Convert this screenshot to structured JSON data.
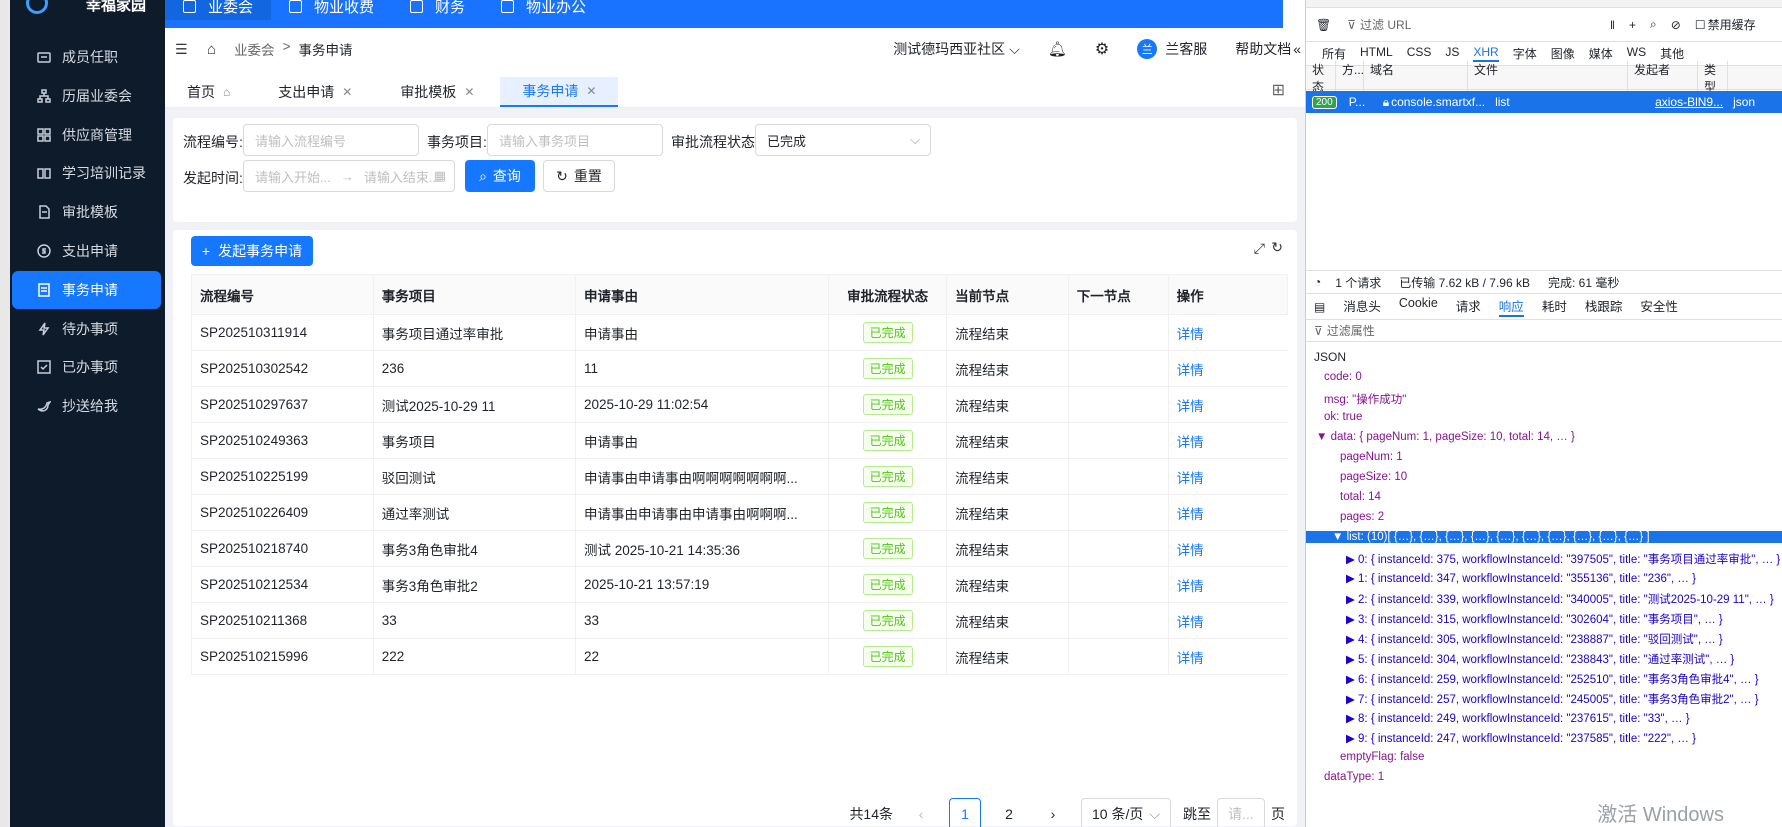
{
  "sidebar": {
    "brand": "幸福家园",
    "items": [
      {
        "label": "成员任职",
        "icon": "id-card-icon"
      },
      {
        "label": "历届业委会",
        "icon": "org-tree-icon"
      },
      {
        "label": "供应商管理",
        "icon": "grid-icon"
      },
      {
        "label": "学习培训记录",
        "icon": "book-icon"
      },
      {
        "label": "审批模板",
        "icon": "document-icon"
      },
      {
        "label": "支出申请",
        "icon": "dollar-icon"
      },
      {
        "label": "事务申请",
        "icon": "list-icon",
        "active": true
      },
      {
        "label": "待办事项",
        "icon": "lightning-icon"
      },
      {
        "label": "已办事项",
        "icon": "checkbox-icon"
      },
      {
        "label": "抄送给我",
        "icon": "bird-icon"
      }
    ]
  },
  "topnav": {
    "items": [
      {
        "label": "业委会",
        "active": true
      },
      {
        "label": "物业收费"
      },
      {
        "label": "财务"
      },
      {
        "label": "物业办公"
      }
    ]
  },
  "header": {
    "breadcrumb": [
      "业委会",
      ">",
      "事务申请"
    ],
    "community": "测试德玛西亚社区",
    "user": "兰客服",
    "user_avatar": "兰",
    "help": "帮助文档"
  },
  "tabs": [
    {
      "label": "首页",
      "closable": false
    },
    {
      "label": "支出申请",
      "closable": true
    },
    {
      "label": "审批模板",
      "closable": true
    },
    {
      "label": "事务申请",
      "closable": true,
      "active": true
    }
  ],
  "filter": {
    "flow_no_label": "流程编号:",
    "flow_no_placeholder": "请输入流程编号",
    "item_label": "事务项目:",
    "item_placeholder": "请输入事务项目",
    "status_label": "审批流程状态:",
    "status_value": "已完成",
    "time_label": "发起时间:",
    "time_start_placeholder": "请输入开始...",
    "time_end_placeholder": "请输入结束...",
    "query_btn": "查询",
    "reset_btn": "重置"
  },
  "create_btn": "发起事务申请",
  "table": {
    "columns": [
      "流程编号",
      "事务项目",
      "申请事由",
      "审批流程状态",
      "当前节点",
      "下一节点",
      "操作"
    ],
    "rows": [
      [
        "SP202510311914",
        "事务项目通过率审批",
        "申请事由",
        "已完成",
        "流程结束",
        "",
        "详情"
      ],
      [
        "SP202510302542",
        "236",
        "11",
        "已完成",
        "流程结束",
        "",
        "详情"
      ],
      [
        "SP202510297637",
        "测试2025-10-29 11",
        "2025-10-29 11:02:54",
        "已完成",
        "流程结束",
        "",
        "详情"
      ],
      [
        "SP202510249363",
        "事务项目",
        "申请事由",
        "已完成",
        "流程结束",
        "",
        "详情"
      ],
      [
        "SP202510225199",
        "驳回测试",
        "申请事由申请事由啊啊啊啊啊啊啊...",
        "已完成",
        "流程结束",
        "",
        "详情"
      ],
      [
        "SP202510226409",
        "通过率测试",
        "申请事由申请事由申请事由啊啊啊...",
        "已完成",
        "流程结束",
        "",
        "详情"
      ],
      [
        "SP202510218740",
        "事务3角色审批4",
        "测试 2025-10-21 14:35:36",
        "已完成",
        "流程结束",
        "",
        "详情"
      ],
      [
        "SP202510212534",
        "事务3角色审批2",
        "2025-10-21 13:57:19",
        "已完成",
        "流程结束",
        "",
        "详情"
      ],
      [
        "SP202510211368",
        "33",
        "33",
        "已完成",
        "流程结束",
        "",
        "详情"
      ],
      [
        "SP202510215996",
        "222",
        "22",
        "已完成",
        "流程结束",
        "",
        "详情"
      ]
    ]
  },
  "pager": {
    "total": "共14条",
    "pages": [
      "1",
      "2"
    ],
    "current": "1",
    "size": "10 条/页",
    "jump_label": "跳至",
    "jump_placeholder": "请...",
    "page_suffix": "页"
  },
  "devtools": {
    "filter_url": "过滤 URL",
    "disable_cache": "禁用缓存",
    "type_tabs": [
      "所有",
      "HTML",
      "CSS",
      "JS",
      "XHR",
      "字体",
      "图像",
      "媒体",
      "WS",
      "其他"
    ],
    "active_type": "XHR",
    "columns": [
      "状态",
      "方...",
      "域名",
      "文件",
      "发起者",
      "类型"
    ],
    "request": {
      "status": "200",
      "method": "P...",
      "domain": "console.smartxf...",
      "file": "list",
      "initiator": "axios-BlN9...",
      "type": "json"
    },
    "summary": {
      "count": "1 个请求",
      "transferred": "已传输 7.62 kB / 7.96 kB",
      "finish": "完成: 61 毫秒"
    },
    "detail_tabs": [
      "消息头",
      "Cookie",
      "请求",
      "响应",
      "耗时",
      "栈跟踪",
      "安全性"
    ],
    "active_detail": "响应",
    "filter_props": "过滤属性",
    "json_label": "JSON",
    "json_lines": [
      "code: 0",
      "msg: \"操作成功\"",
      "ok: true",
      "▼ data: { pageNum: 1, pageSize: 10, total: 14, … }",
      "pageNum: 1",
      "pageSize: 10",
      "total: 14",
      "pages: 2",
      "▼ list: (10)[ {…}, {…}, {…}, {…}, {…}, {…}, {…}, {…}, {…}, {…} ]",
      "▶ 0: { instanceId: 375, workflowInstanceId: \"397505\", title: \"事务项目通过率审批\", … }",
      "▶ 1: { instanceId: 347, workflowInstanceId: \"355136\", title: \"236\", … }",
      "▶ 2: { instanceId: 339, workflowInstanceId: \"340005\", title: \"测试2025-10-29 11\", … }",
      "▶ 3: { instanceId: 315, workflowInstanceId: \"302604\", title: \"事务项目\", … }",
      "▶ 4: { instanceId: 305, workflowInstanceId: \"238887\", title: \"驳回测试\", … }",
      "▶ 5: { instanceId: 304, workflowInstanceId: \"238843\", title: \"通过率测试\", … }",
      "▶ 6: { instanceId: 259, workflowInstanceId: \"252510\", title: \"事务3角色审批4\", … }",
      "▶ 7: { instanceId: 257, workflowInstanceId: \"245005\", title: \"事务3角色审批2\", … }",
      "▶ 8: { instanceId: 249, workflowInstanceId: \"237615\", title: \"33\", … }",
      "▶ 9: { instanceId: 247, workflowInstanceId: \"237585\", title: \"222\", … }",
      "emptyFlag: false",
      "dataType: 1"
    ]
  },
  "os_watermark": "激活 Windows"
}
